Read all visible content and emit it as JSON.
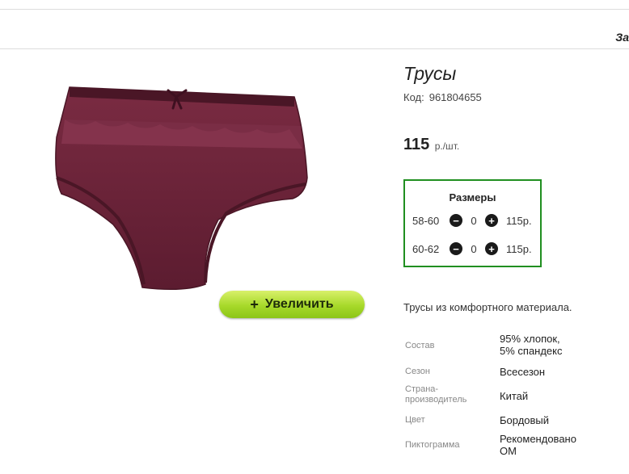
{
  "header": {
    "cut_text": "За"
  },
  "product": {
    "title": "Трусы",
    "code_label": "Код:",
    "code_value": "961804655",
    "price_amount": "115",
    "price_unit": "р./шт.",
    "zoom_button": {
      "icon": "+",
      "label": "Увеличить"
    },
    "description": "Трусы из комфортного материала.",
    "image_colors": {
      "fabric": "#6b2438",
      "fabric_dark": "#4a1626",
      "lace": "#7a2d45"
    }
  },
  "sizes": {
    "title": "Размеры",
    "rows": [
      {
        "label": "58-60",
        "minus_icon": "−",
        "qty": "0",
        "plus_icon": "+",
        "price": "115р."
      },
      {
        "label": "60-62",
        "minus_icon": "−",
        "qty": "0",
        "plus_icon": "+",
        "price": "115р."
      }
    ]
  },
  "properties": [
    {
      "key": "Состав",
      "value": "95% хлопок,\n5% спандекс"
    },
    {
      "key": "Сезон",
      "value": "Всесезон"
    },
    {
      "key": "Страна-\nпроизводитель",
      "value": "Китай"
    },
    {
      "key": "Цвет",
      "value": "Бордовый"
    },
    {
      "key": "Пиктограмма",
      "value": "Рекомендовано\nОМ"
    }
  ]
}
